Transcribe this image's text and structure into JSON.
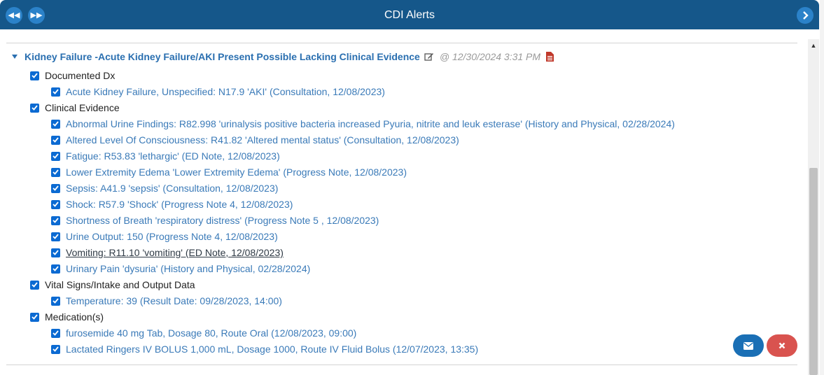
{
  "header": {
    "title": "CDI Alerts"
  },
  "alert": {
    "title": "Kidney Failure -Acute Kidney Failure/AKI Present Possible Lacking Clinical Evidence",
    "date": "@ 12/30/2024 3:31 PM"
  },
  "categories": [
    {
      "label": "Documented Dx",
      "items": [
        {
          "label": "Acute Kidney Failure, Unspecified: N17.9 'AKI' (Consultation, 12/08/2023)"
        }
      ]
    },
    {
      "label": "Clinical Evidence",
      "items": [
        {
          "label": "Abnormal Urine Findings: R82.998 'urinalysis positive bacteria increased Pyuria, nitrite and leuk esterase' (History and Physical, 02/28/2024)"
        },
        {
          "label": "Altered Level Of Consciousness: R41.82 'Altered mental status' (Consultation, 12/08/2023)"
        },
        {
          "label": "Fatigue: R53.83 'lethargic' (ED Note, 12/08/2023)"
        },
        {
          "label": "Lower Extremity Edema 'Lower Extremity Edema' (Progress Note, 12/08/2023)"
        },
        {
          "label": "Sepsis: A41.9 'sepsis' (Consultation, 12/08/2023)"
        },
        {
          "label": "Shock: R57.9 'Shock' (Progress Note 4, 12/08/2023)"
        },
        {
          "label": "Shortness of Breath 'respiratory distress' (Progress Note 5 , 12/08/2023)"
        },
        {
          "label": "Urine Output: 150 (Progress Note 4, 12/08/2023)"
        },
        {
          "label": "Vomiting: R11.10 'vomiting' (ED Note, 12/08/2023)"
        },
        {
          "label": "Urinary Pain 'dysuria' (History and Physical, 02/28/2024)"
        }
      ]
    },
    {
      "label": "Vital Signs/Intake and Output Data",
      "items": [
        {
          "label": "Temperature: 39 (Result Date: 09/28/2023, 14:00)"
        }
      ]
    },
    {
      "label": "Medication(s)",
      "items": [
        {
          "label": "furosemide 40 mg Tab, Dosage 80, Route Oral (12/08/2023, 09:00)"
        },
        {
          "label": "Lactated Ringers IV BOLUS 1,000 mL, Dosage 1000, Route IV Fluid Bolus (12/07/2023, 13:35)"
        }
      ]
    }
  ],
  "colors": {
    "header": "#15578a",
    "link": "#3a7ab8",
    "checkbox": "#0b6ad2",
    "email": "#1a6fb5",
    "close": "#d9534f"
  },
  "icons": {
    "back": "rewind-icon",
    "forward": "fast-forward-icon",
    "next": "chevron-right-icon",
    "edit": "edit-icon",
    "document": "document-icon",
    "email": "envelope-icon",
    "close": "close-icon"
  }
}
